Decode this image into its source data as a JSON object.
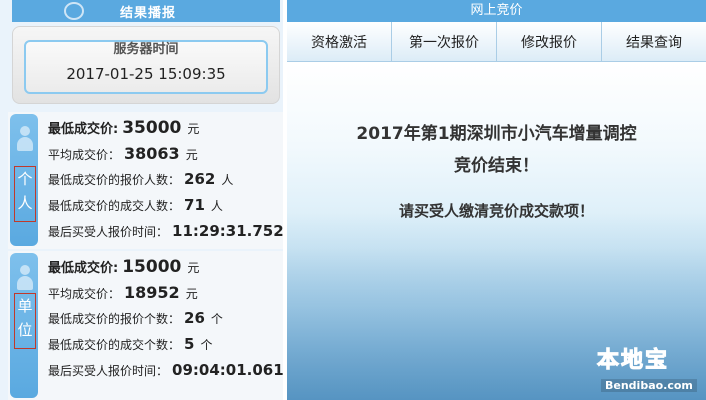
{
  "left_panel": {
    "header_title": "结果播报",
    "server_label": "服务器时间",
    "server_time": "2017-01-25 15:09:35"
  },
  "personal": {
    "tab_label": "个人",
    "rows": [
      {
        "label": "最低成交价:",
        "value": "35000",
        "unit": "元"
      },
      {
        "label": "平均成交价：",
        "value": "38063",
        "unit": "元"
      },
      {
        "label": "最低成交价的报价人数：",
        "value": "262",
        "unit": "人"
      },
      {
        "label": "最低成交价的成交人数：",
        "value": "71",
        "unit": "人"
      },
      {
        "label": "最后买受人报价时间：",
        "value": "11:29:31.752",
        "unit": ""
      }
    ]
  },
  "unit": {
    "tab_label": "单位",
    "rows": [
      {
        "label": "最低成交价:",
        "value": "15000",
        "unit": "元"
      },
      {
        "label": "平均成交价：",
        "value": "18952",
        "unit": "元"
      },
      {
        "label": "最低成交价的报价个数：",
        "value": "26",
        "unit": "个"
      },
      {
        "label": "最低成交价的成交个数：",
        "value": "5",
        "unit": "个"
      },
      {
        "label": "最后买受人报价时间：",
        "value": "09:04:01.061",
        "unit": ""
      }
    ]
  },
  "right_panel": {
    "header_title": "网上竞价",
    "tabs": [
      "资格激活",
      "第一次报价",
      "修改报价",
      "结果查询"
    ],
    "message_line1": "2017年第1期深圳市小汽车增量调控",
    "message_line2": "竞价结束！",
    "message_sub": "请买受人缴清竞价成交款项！"
  },
  "watermark": {
    "logo_cn": "本地宝",
    "logo_en": "Bendibao.com"
  },
  "colors": {
    "accent": "#5aa9e0",
    "tab_border": "#c0392b",
    "logo": "#f39a2b"
  }
}
